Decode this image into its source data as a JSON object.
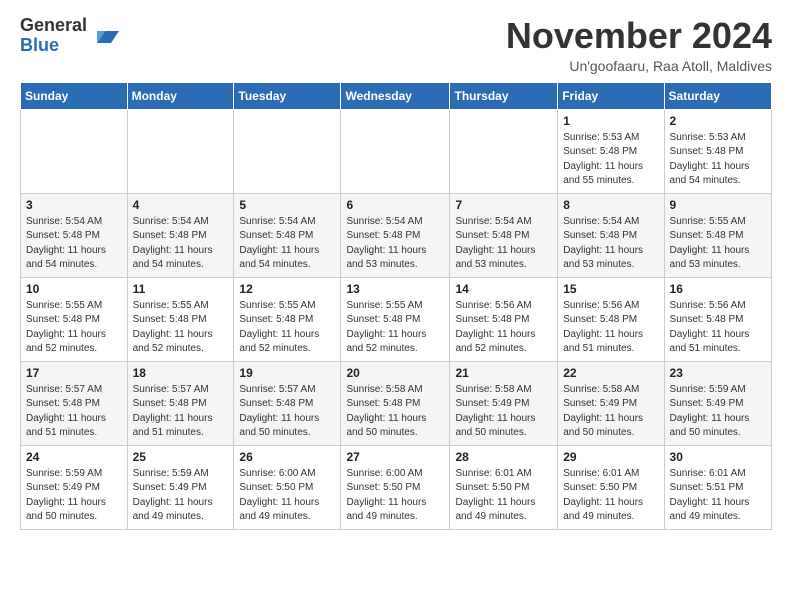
{
  "logo": {
    "general": "General",
    "blue": "Blue"
  },
  "title": "November 2024",
  "subtitle": "Un'goofaaru, Raa Atoll, Maldives",
  "headers": [
    "Sunday",
    "Monday",
    "Tuesday",
    "Wednesday",
    "Thursday",
    "Friday",
    "Saturday"
  ],
  "weeks": [
    [
      {
        "day": "",
        "info": ""
      },
      {
        "day": "",
        "info": ""
      },
      {
        "day": "",
        "info": ""
      },
      {
        "day": "",
        "info": ""
      },
      {
        "day": "",
        "info": ""
      },
      {
        "day": "1",
        "info": "Sunrise: 5:53 AM\nSunset: 5:48 PM\nDaylight: 11 hours and 55 minutes."
      },
      {
        "day": "2",
        "info": "Sunrise: 5:53 AM\nSunset: 5:48 PM\nDaylight: 11 hours and 54 minutes."
      }
    ],
    [
      {
        "day": "3",
        "info": "Sunrise: 5:54 AM\nSunset: 5:48 PM\nDaylight: 11 hours and 54 minutes."
      },
      {
        "day": "4",
        "info": "Sunrise: 5:54 AM\nSunset: 5:48 PM\nDaylight: 11 hours and 54 minutes."
      },
      {
        "day": "5",
        "info": "Sunrise: 5:54 AM\nSunset: 5:48 PM\nDaylight: 11 hours and 54 minutes."
      },
      {
        "day": "6",
        "info": "Sunrise: 5:54 AM\nSunset: 5:48 PM\nDaylight: 11 hours and 53 minutes."
      },
      {
        "day": "7",
        "info": "Sunrise: 5:54 AM\nSunset: 5:48 PM\nDaylight: 11 hours and 53 minutes."
      },
      {
        "day": "8",
        "info": "Sunrise: 5:54 AM\nSunset: 5:48 PM\nDaylight: 11 hours and 53 minutes."
      },
      {
        "day": "9",
        "info": "Sunrise: 5:55 AM\nSunset: 5:48 PM\nDaylight: 11 hours and 53 minutes."
      }
    ],
    [
      {
        "day": "10",
        "info": "Sunrise: 5:55 AM\nSunset: 5:48 PM\nDaylight: 11 hours and 52 minutes."
      },
      {
        "day": "11",
        "info": "Sunrise: 5:55 AM\nSunset: 5:48 PM\nDaylight: 11 hours and 52 minutes."
      },
      {
        "day": "12",
        "info": "Sunrise: 5:55 AM\nSunset: 5:48 PM\nDaylight: 11 hours and 52 minutes."
      },
      {
        "day": "13",
        "info": "Sunrise: 5:55 AM\nSunset: 5:48 PM\nDaylight: 11 hours and 52 minutes."
      },
      {
        "day": "14",
        "info": "Sunrise: 5:56 AM\nSunset: 5:48 PM\nDaylight: 11 hours and 52 minutes."
      },
      {
        "day": "15",
        "info": "Sunrise: 5:56 AM\nSunset: 5:48 PM\nDaylight: 11 hours and 51 minutes."
      },
      {
        "day": "16",
        "info": "Sunrise: 5:56 AM\nSunset: 5:48 PM\nDaylight: 11 hours and 51 minutes."
      }
    ],
    [
      {
        "day": "17",
        "info": "Sunrise: 5:57 AM\nSunset: 5:48 PM\nDaylight: 11 hours and 51 minutes."
      },
      {
        "day": "18",
        "info": "Sunrise: 5:57 AM\nSunset: 5:48 PM\nDaylight: 11 hours and 51 minutes."
      },
      {
        "day": "19",
        "info": "Sunrise: 5:57 AM\nSunset: 5:48 PM\nDaylight: 11 hours and 50 minutes."
      },
      {
        "day": "20",
        "info": "Sunrise: 5:58 AM\nSunset: 5:48 PM\nDaylight: 11 hours and 50 minutes."
      },
      {
        "day": "21",
        "info": "Sunrise: 5:58 AM\nSunset: 5:49 PM\nDaylight: 11 hours and 50 minutes."
      },
      {
        "day": "22",
        "info": "Sunrise: 5:58 AM\nSunset: 5:49 PM\nDaylight: 11 hours and 50 minutes."
      },
      {
        "day": "23",
        "info": "Sunrise: 5:59 AM\nSunset: 5:49 PM\nDaylight: 11 hours and 50 minutes."
      }
    ],
    [
      {
        "day": "24",
        "info": "Sunrise: 5:59 AM\nSunset: 5:49 PM\nDaylight: 11 hours and 50 minutes."
      },
      {
        "day": "25",
        "info": "Sunrise: 5:59 AM\nSunset: 5:49 PM\nDaylight: 11 hours and 49 minutes."
      },
      {
        "day": "26",
        "info": "Sunrise: 6:00 AM\nSunset: 5:50 PM\nDaylight: 11 hours and 49 minutes."
      },
      {
        "day": "27",
        "info": "Sunrise: 6:00 AM\nSunset: 5:50 PM\nDaylight: 11 hours and 49 minutes."
      },
      {
        "day": "28",
        "info": "Sunrise: 6:01 AM\nSunset: 5:50 PM\nDaylight: 11 hours and 49 minutes."
      },
      {
        "day": "29",
        "info": "Sunrise: 6:01 AM\nSunset: 5:50 PM\nDaylight: 11 hours and 49 minutes."
      },
      {
        "day": "30",
        "info": "Sunrise: 6:01 AM\nSunset: 5:51 PM\nDaylight: 11 hours and 49 minutes."
      }
    ]
  ]
}
